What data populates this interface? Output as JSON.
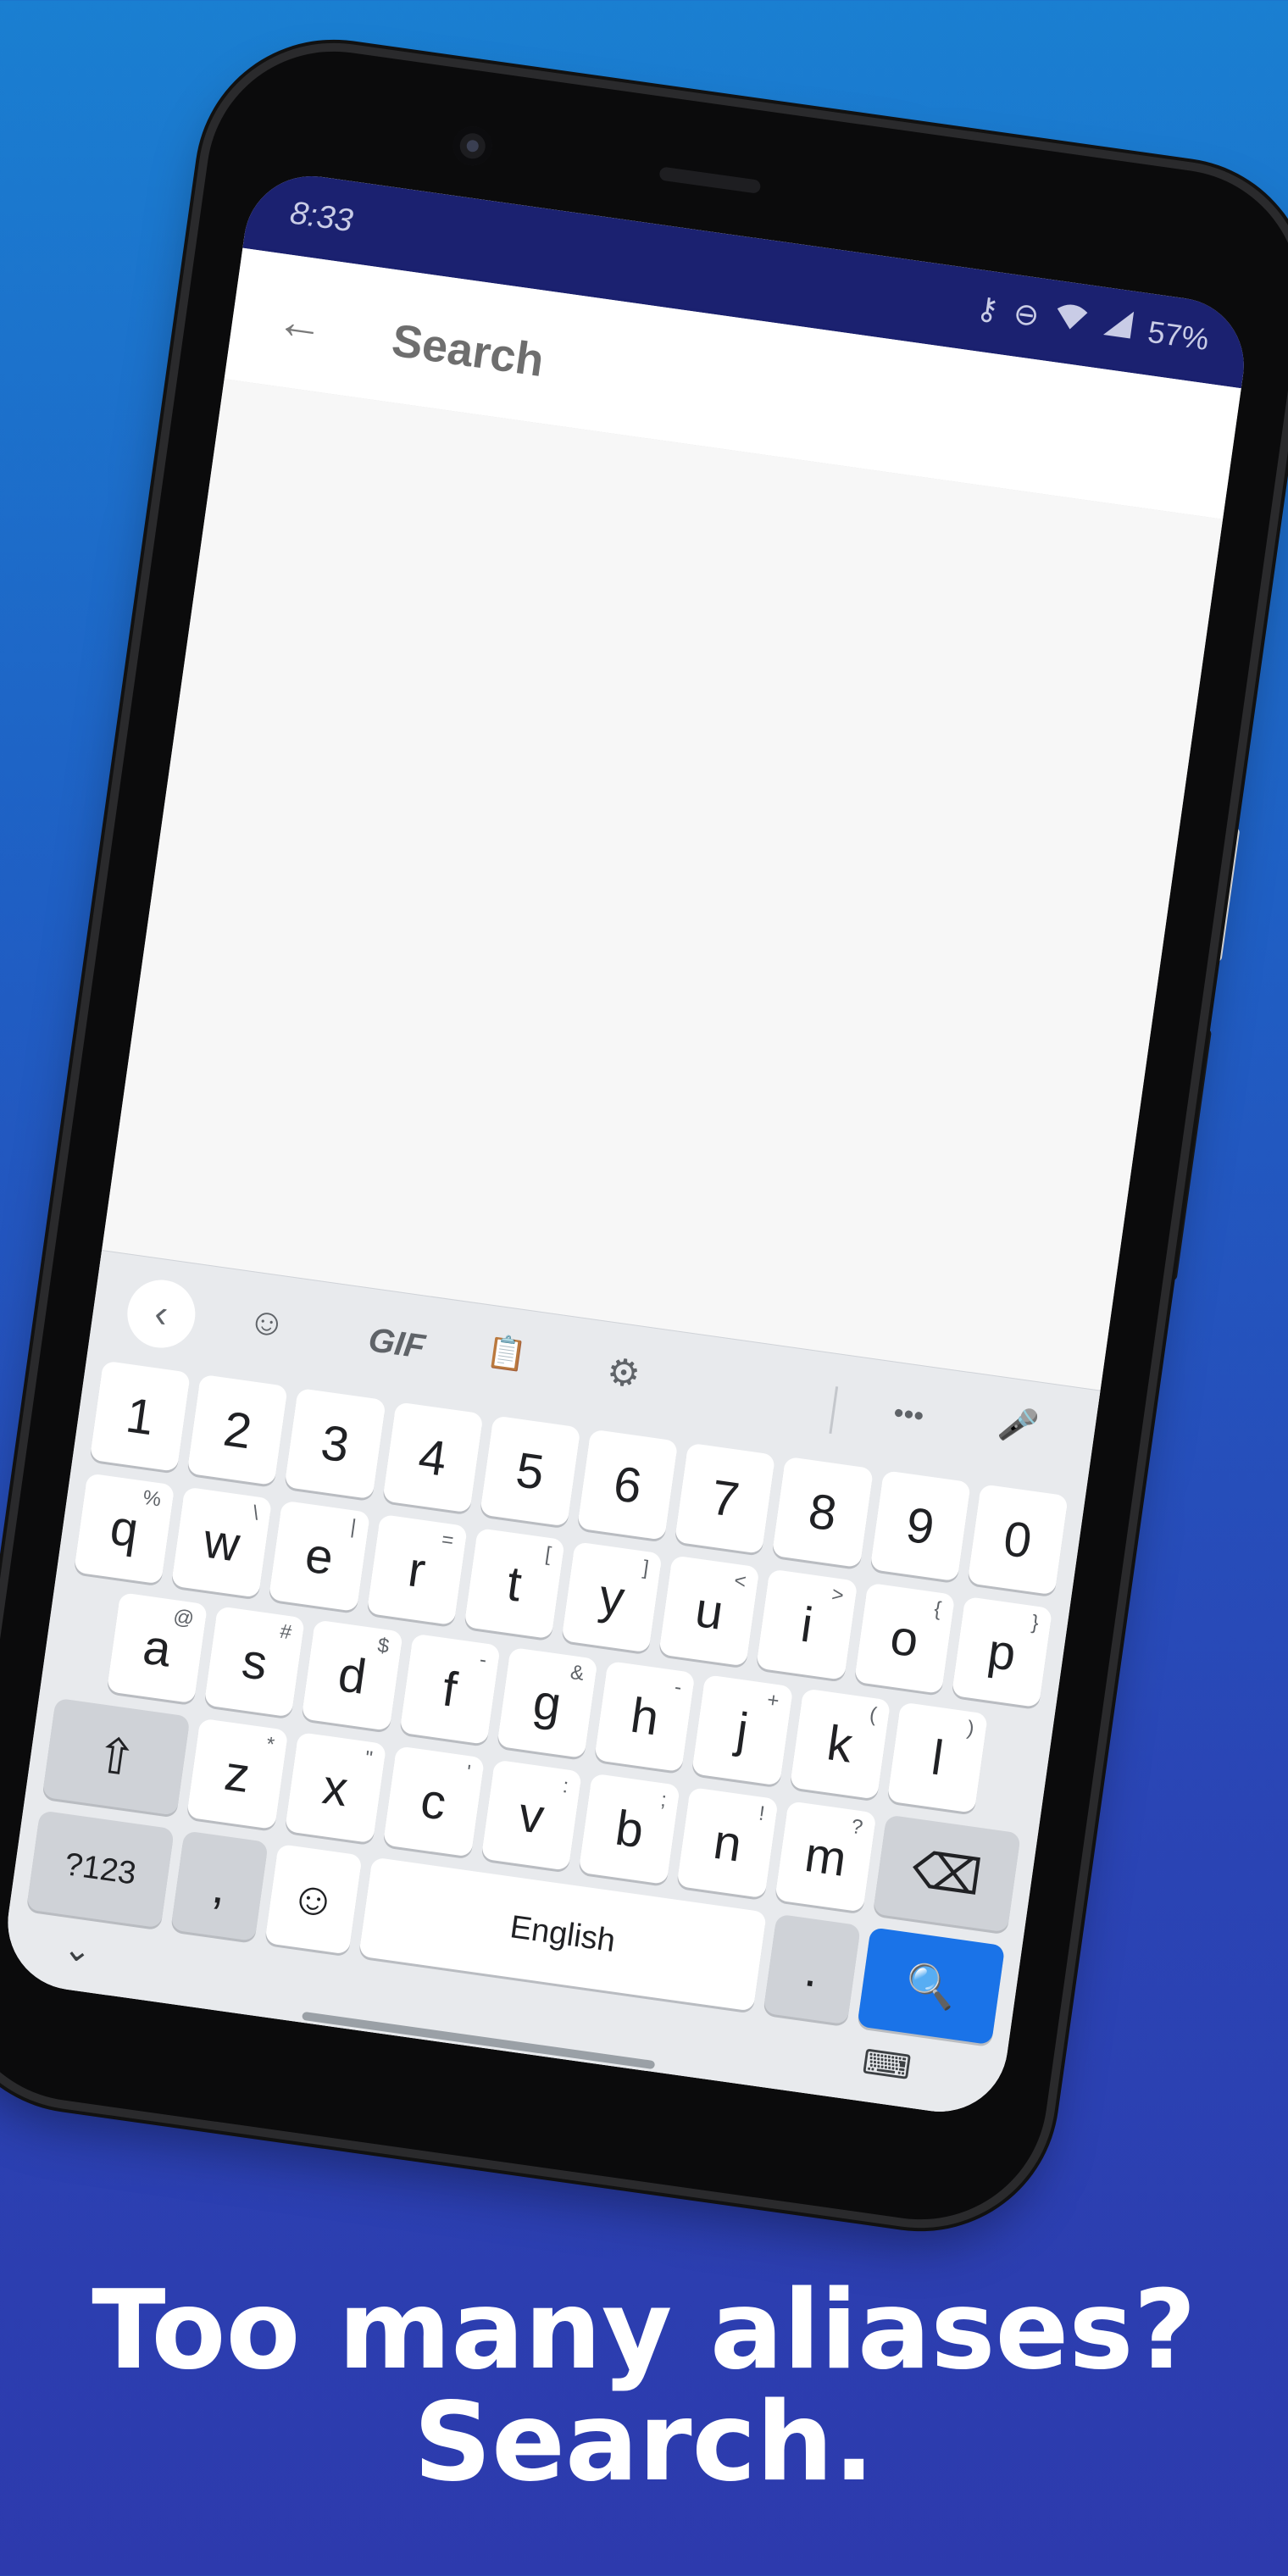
{
  "headline": {
    "line1": "Too many aliases?",
    "line2": "Search."
  },
  "statusbar": {
    "time": "8:33",
    "battery": "57%"
  },
  "appbar": {
    "title": "Search",
    "back_glyph": "←"
  },
  "keyboard": {
    "toolbar": {
      "back_glyph": "‹",
      "sticker_glyph": "☺",
      "gif_label": "GIF",
      "clipboard_glyph": "📋",
      "settings_glyph": "⚙",
      "more_glyph": "•••",
      "mic_glyph": "🎤"
    },
    "number_row": [
      "1",
      "2",
      "3",
      "4",
      "5",
      "6",
      "7",
      "8",
      "9",
      "0"
    ],
    "row1": [
      {
        "key": "q",
        "hint": "%"
      },
      {
        "key": "w",
        "hint": "\\"
      },
      {
        "key": "e",
        "hint": "|"
      },
      {
        "key": "r",
        "hint": "="
      },
      {
        "key": "t",
        "hint": "["
      },
      {
        "key": "y",
        "hint": "]"
      },
      {
        "key": "u",
        "hint": "<"
      },
      {
        "key": "i",
        "hint": ">"
      },
      {
        "key": "o",
        "hint": "{"
      },
      {
        "key": "p",
        "hint": "}"
      }
    ],
    "row2": [
      {
        "key": "a",
        "hint": "@"
      },
      {
        "key": "s",
        "hint": "#"
      },
      {
        "key": "d",
        "hint": "$"
      },
      {
        "key": "f",
        "hint": "-"
      },
      {
        "key": "g",
        "hint": "&"
      },
      {
        "key": "h",
        "hint": "-"
      },
      {
        "key": "j",
        "hint": "+"
      },
      {
        "key": "k",
        "hint": "("
      },
      {
        "key": "l",
        "hint": ")"
      }
    ],
    "row3": [
      {
        "key": "z",
        "hint": "*"
      },
      {
        "key": "x",
        "hint": "\""
      },
      {
        "key": "c",
        "hint": "'"
      },
      {
        "key": "v",
        "hint": ":"
      },
      {
        "key": "b",
        "hint": ";"
      },
      {
        "key": "n",
        "hint": "!"
      },
      {
        "key": "m",
        "hint": "?"
      }
    ],
    "shift_glyph": "⇧",
    "backspace_glyph": "⌫",
    "symbols_label": "?123",
    "comma_label": ",",
    "emoji_glyph": "☺",
    "space_label": "English",
    "period_label": ".",
    "search_glyph": "🔍",
    "hide_glyph": "⌄",
    "switch_keyboard_glyph": "⌨"
  },
  "colors": {
    "background_top": "#1a7fd1",
    "background_bottom": "#2d3aad",
    "statusbar": "#1b2170",
    "search_key": "#1a73e8"
  }
}
